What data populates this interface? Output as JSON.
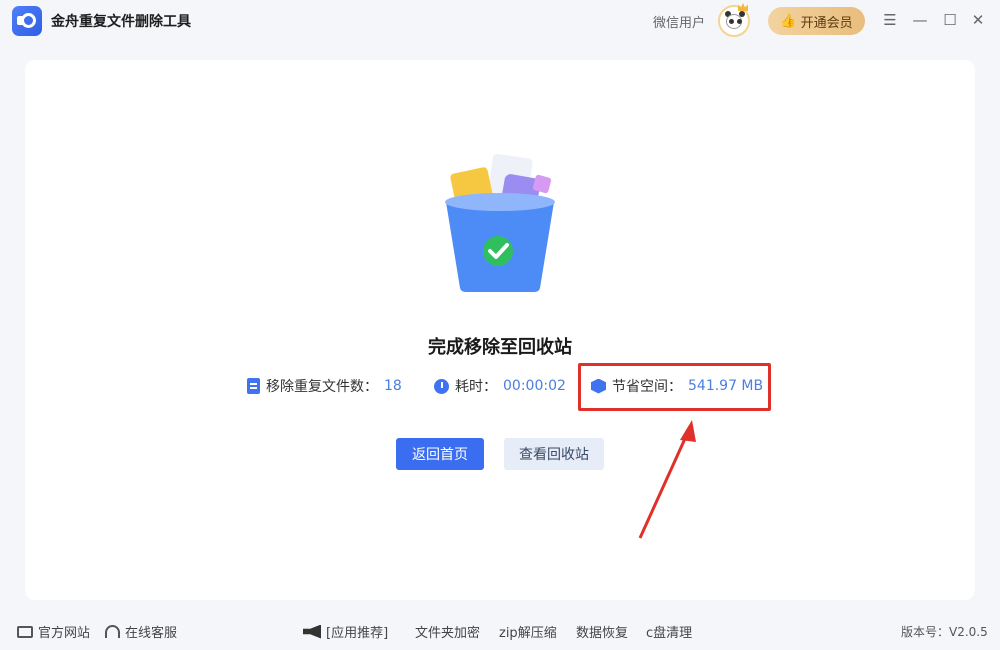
{
  "titlebar": {
    "app_title": "金舟重复文件删除工具",
    "user_label": "微信用户",
    "vip_label": "开通会员"
  },
  "result": {
    "title": "完成移除至回收站",
    "stats": [
      {
        "label": "移除重复文件数：",
        "value": "18",
        "icon": "document-icon"
      },
      {
        "label": "耗时：",
        "value": "00:00:02",
        "icon": "timer-icon"
      },
      {
        "label": "节省空间：",
        "value": "541.97 MB",
        "icon": "cube-icon"
      }
    ],
    "back_button": "返回首页",
    "view_bin_button": "查看回收站"
  },
  "footer": {
    "official_site": "官方网站",
    "online_service": "在线客服",
    "recommend": "[应用推荐]",
    "apps": [
      "文件夹加密",
      "zip解压缩",
      "数据恢复",
      "c盘清理"
    ],
    "version": "版本号：V2.0.5"
  },
  "colors": {
    "accent": "#3b6df0",
    "highlight": "#e0302a",
    "vip_gold": "#e9bd7c"
  }
}
